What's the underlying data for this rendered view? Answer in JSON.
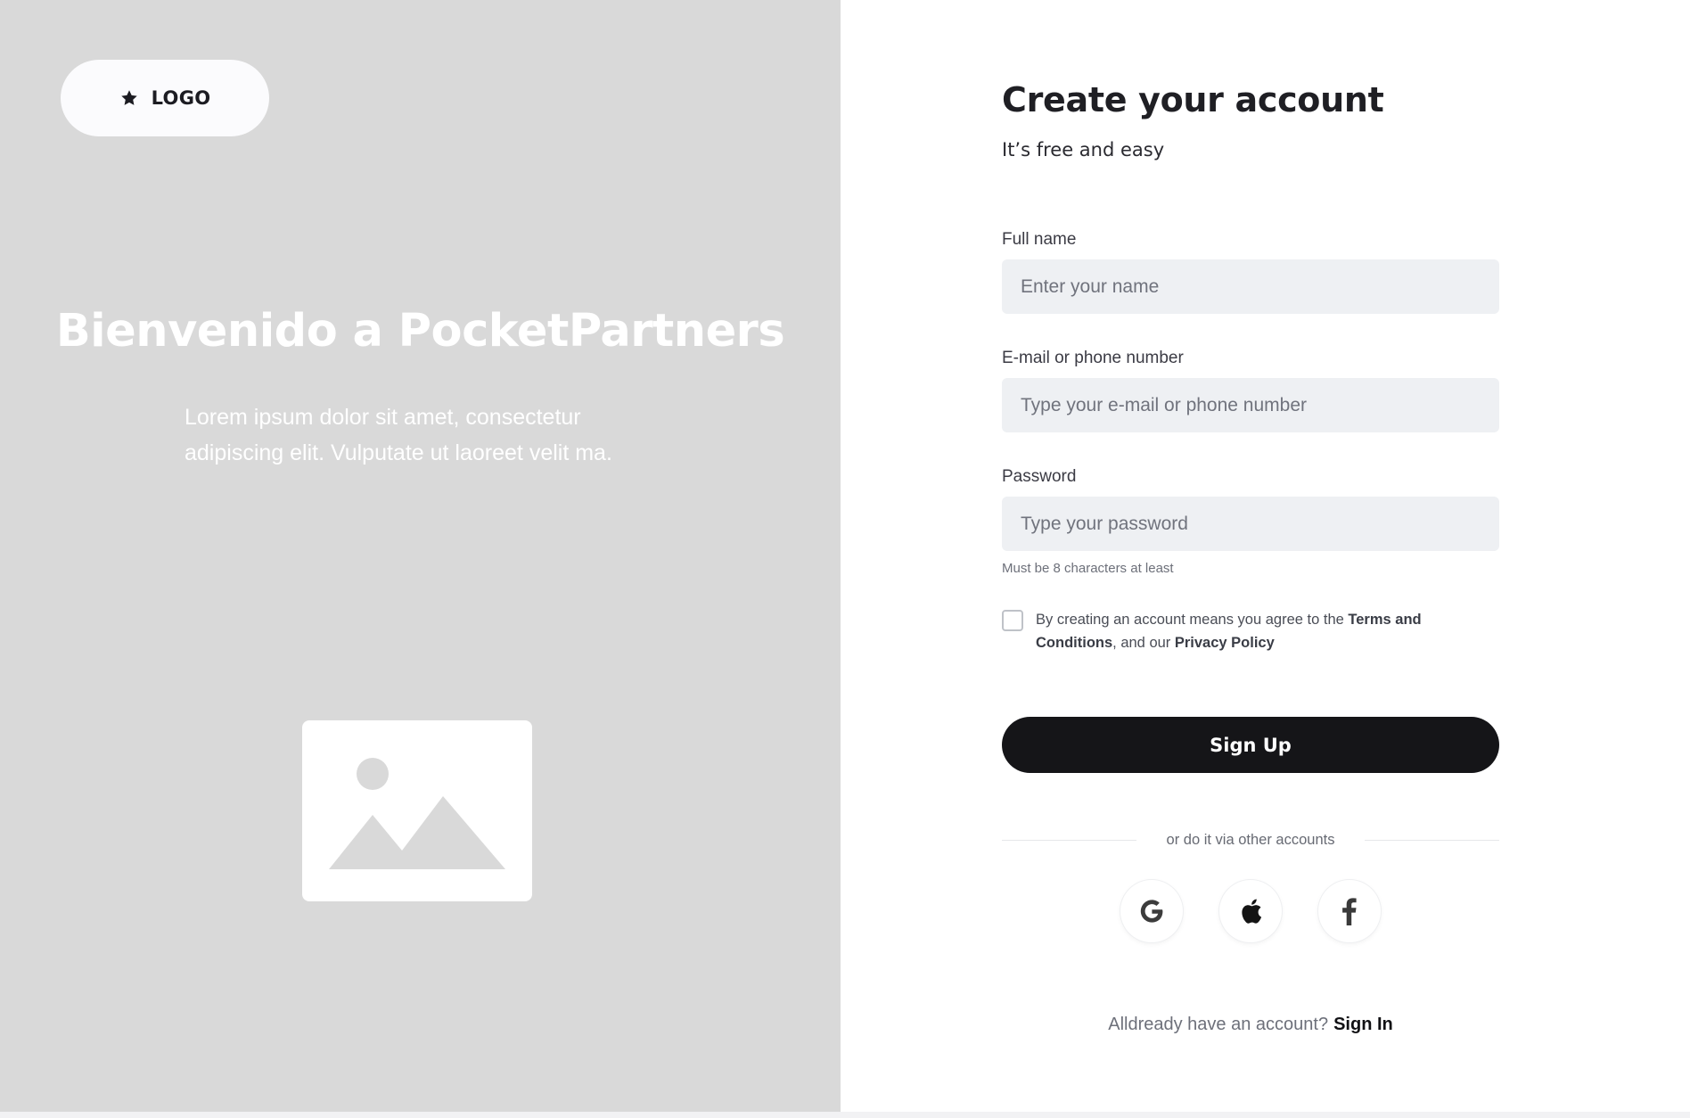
{
  "brand": {
    "logo_label": "LOGO",
    "hero_title": "Bienvenido a PocketPartners",
    "hero_body": "Lorem ipsum dolor sit amet, consectetur adipiscing elit. Vulputate ut laoreet velit ma.",
    "hero_image_icon": "image-placeholder-icon"
  },
  "form": {
    "title": "Create your account",
    "subtitle": "It’s free and easy",
    "fields": {
      "full_name": {
        "label": "Full name",
        "placeholder": "Enter your name",
        "value": ""
      },
      "contact": {
        "label": "E-mail or phone number",
        "placeholder": "Type your e-mail or phone number",
        "value": ""
      },
      "password": {
        "label": "Password",
        "placeholder": "Type your password",
        "value": "",
        "hint": "Must be 8 characters at least"
      }
    },
    "agreement": {
      "checked": false,
      "prefix": "By creating an account means you agree to the ",
      "terms_link": "Terms and Conditions",
      "middle": ", and our ",
      "privacy_link": "Privacy Policy"
    },
    "submit_label": "Sign Up",
    "divider_text": "or do it via other accounts",
    "social_providers": [
      {
        "name": "Google",
        "icon": "google-icon"
      },
      {
        "name": "Apple",
        "icon": "apple-icon"
      },
      {
        "name": "Facebook",
        "icon": "facebook-icon"
      }
    ],
    "signin_prompt": "Alldready have an account?",
    "signin_link": "Sign In"
  },
  "colors": {
    "left_panel_bg": "#d9d9d9",
    "primary_button": "#151518",
    "input_bg": "#eef0f3"
  }
}
